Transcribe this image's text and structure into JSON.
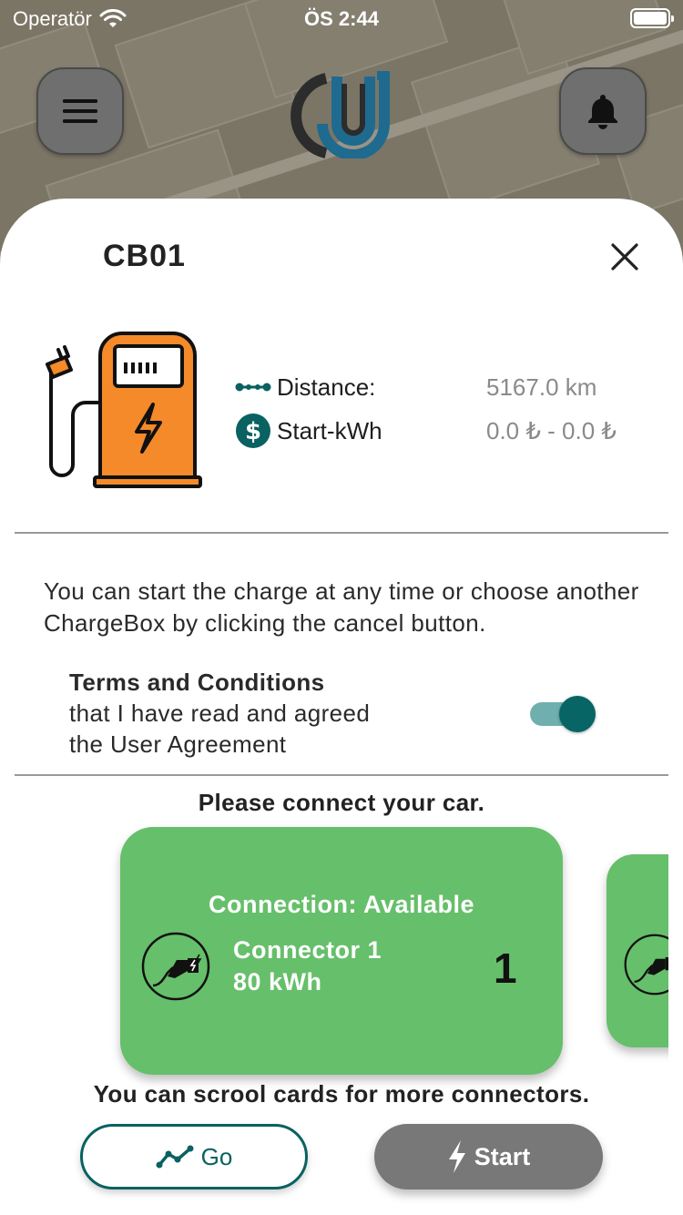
{
  "status_bar": {
    "carrier": "Operatör",
    "time": "ÖS 2:44"
  },
  "colors": {
    "accent": "#0a6161",
    "card_green": "#66bf6a",
    "pump_orange": "#f58a2a",
    "start_gray": "#787878"
  },
  "header": {
    "menu_icon": "hamburger-icon",
    "bell_icon": "bell-icon"
  },
  "chargebox": {
    "title": "CB01",
    "distance_label": "Distance:",
    "distance_value": "5167.0 km",
    "kwh_label": "Start-kWh",
    "kwh_value": "0.0 ₺ - 0.0 ₺"
  },
  "note": "You can start the charge at any time or choose another ChargeBox by clicking the cancel button.",
  "terms": {
    "title": "Terms and Conditions",
    "line1": "that I have read and agreed",
    "line2": "the User Agreement",
    "agreed": true
  },
  "connect_title": "Please connect your car.",
  "connector": {
    "status": "Connection:  Available",
    "name": "Connector 1",
    "power": "80 kWh",
    "number": "1"
  },
  "scroll_hint": "You can scrool cards for more connectors.",
  "buttons": {
    "go": "Go",
    "start": "Start"
  }
}
